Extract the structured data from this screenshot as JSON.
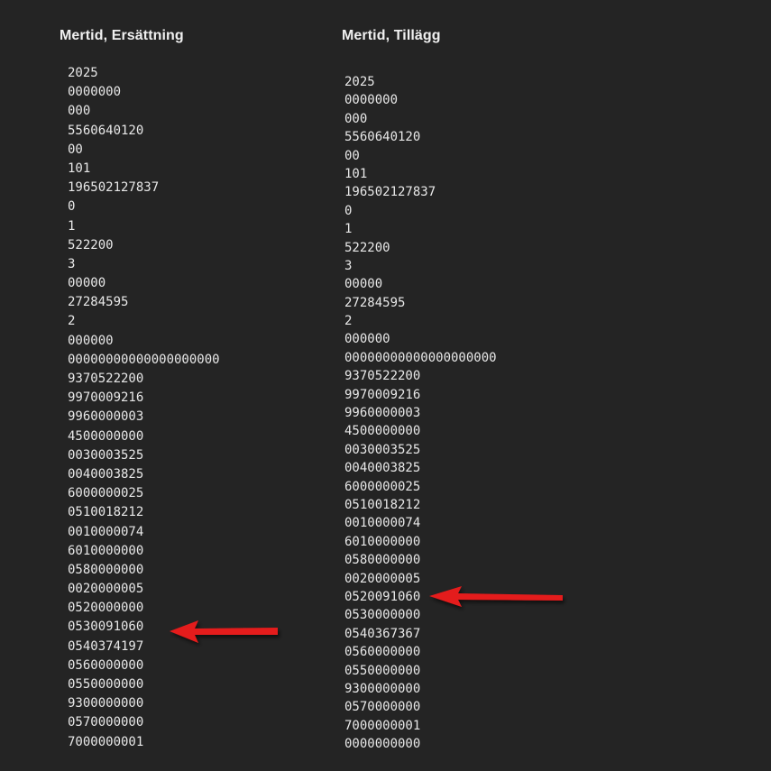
{
  "columns": {
    "left": {
      "title": "Mertid, Ersättning",
      "codes": [
        "2025",
        "0000000",
        "000",
        "5560640120",
        "00",
        "101",
        "196502127837",
        "0",
        "1",
        "522200",
        "3",
        "00000",
        "27284595",
        "2",
        "000000",
        "00000000000000000000",
        "9370522200",
        "9970009216",
        "9960000003",
        "4500000000",
        "0030003525",
        "0040003825",
        "6000000025",
        "0510018212",
        "0010000074",
        "6010000000",
        "0580000000",
        "0020000005",
        "0520000000",
        "0530091060",
        "0540374197",
        "0560000000",
        "0550000000",
        "9300000000",
        "0570000000",
        "7000000001"
      ],
      "highlighted_code": "0530091060"
    },
    "right": {
      "title": "Mertid, Tillägg",
      "codes": [
        "2025",
        "0000000",
        "000",
        "5560640120",
        "00",
        "101",
        "196502127837",
        "0",
        "1",
        "522200",
        "3",
        "00000",
        "27284595",
        "2",
        "000000",
        "00000000000000000000",
        "9370522200",
        "9970009216",
        "9960000003",
        "4500000000",
        "0030003525",
        "0040003825",
        "6000000025",
        "0510018212",
        "0010000074",
        "6010000000",
        "0580000000",
        "0020000005",
        "0520091060",
        "0530000000",
        "0540367367",
        "0560000000",
        "0550000000",
        "9300000000",
        "0570000000",
        "7000000001",
        "0000000000"
      ],
      "highlighted_code": "0520091060"
    }
  },
  "colors": {
    "background": "#242424",
    "text": "#e8e8e8",
    "arrow": "#e41a1a"
  },
  "icons": {
    "annotation": "left-pointing-red-arrow-icon"
  }
}
